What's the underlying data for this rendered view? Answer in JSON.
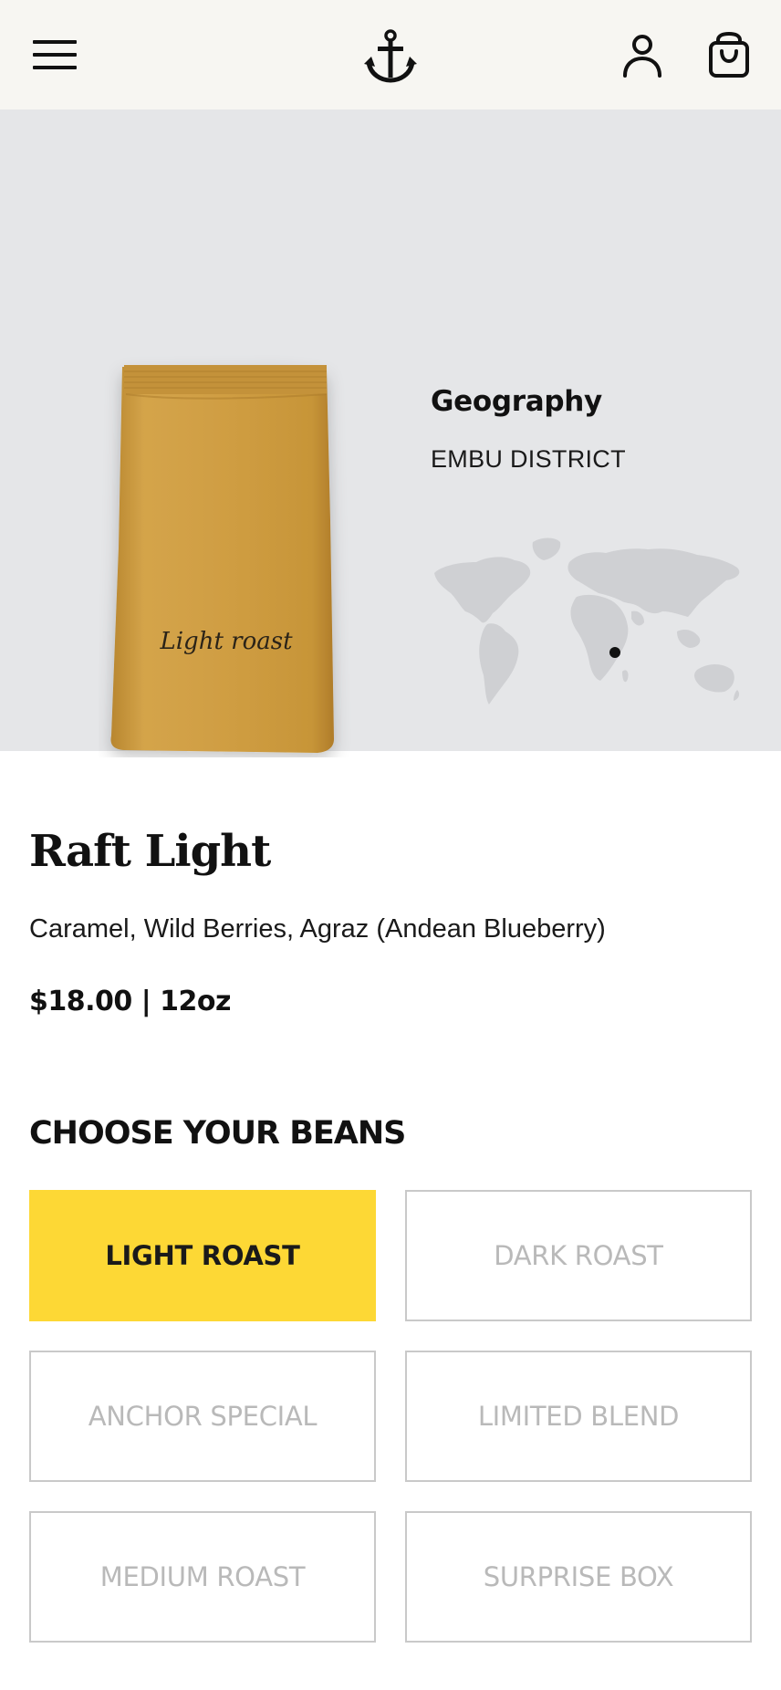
{
  "header": {
    "menu_icon": "hamburger-menu-icon",
    "logo_icon": "anchor-logo-icon",
    "account_icon": "user-account-icon",
    "cart_icon": "shopping-bag-icon"
  },
  "hero": {
    "bag_label": "Light roast",
    "geography_title": "Geography",
    "geography_value": "EMBU DISTRICT",
    "map_icon": "world-map-icon"
  },
  "product": {
    "name": "Raft Light",
    "notes": "Caramel, Wild Berries, Agraz (Andean Blueberry)",
    "price": "$18.00 | 12oz"
  },
  "beans": {
    "heading": "CHOOSE YOUR BEANS",
    "options": [
      {
        "label": "LIGHT ROAST",
        "selected": true
      },
      {
        "label": "DARK ROAST",
        "selected": false
      },
      {
        "label": "ANCHOR SPECIAL",
        "selected": false
      },
      {
        "label": "LIMITED BLEND",
        "selected": false
      },
      {
        "label": "MEDIUM ROAST",
        "selected": false
      },
      {
        "label": "SURPRISE BOX",
        "selected": false
      }
    ]
  },
  "colors": {
    "header_bg": "#f7f6f2",
    "hero_bg": "#e5e6e8",
    "accent": "#fdd835",
    "bag": "#c99a3e"
  }
}
